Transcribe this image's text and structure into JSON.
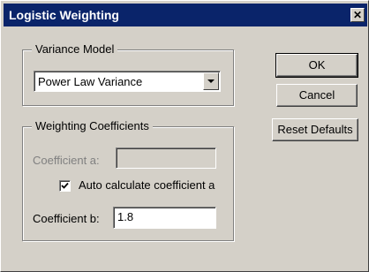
{
  "window": {
    "title": "Logistic Weighting",
    "close_glyph": "✕"
  },
  "variance_model": {
    "legend": "Variance Model",
    "selected": "Power Law Variance",
    "dropdown_icon": "chevron-down-icon"
  },
  "weighting": {
    "legend": "Weighting Coefficients",
    "coef_a_label": "Coefficient a:",
    "coef_a_value": "",
    "auto_calc_label": "Auto calculate coefficient a",
    "auto_calc_checked": true,
    "coef_b_label": "Coefficient b:",
    "coef_b_value": "1.8"
  },
  "buttons": {
    "ok": "OK",
    "cancel": "Cancel",
    "reset": "Reset Defaults"
  },
  "colors": {
    "titlebar": "#0a246a",
    "face": "#d4d0c8"
  }
}
